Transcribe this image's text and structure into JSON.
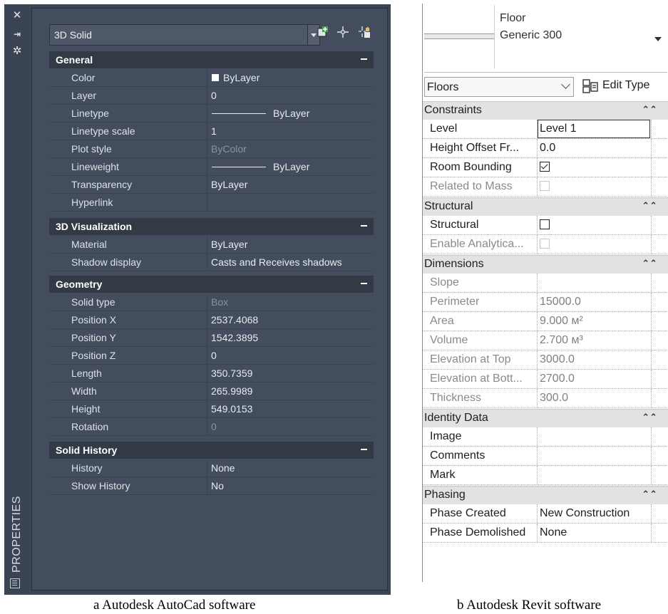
{
  "autocad": {
    "side_label": "PROPERTIES",
    "object_type": "3D Solid",
    "sections": [
      {
        "title": "General",
        "rows": [
          {
            "key": "Color",
            "value": "ByLayer"
          },
          {
            "key": "Layer",
            "value": "0"
          },
          {
            "key": "Linetype",
            "value": "ByLayer"
          },
          {
            "key": "Linetype scale",
            "value": "1"
          },
          {
            "key": "Plot style",
            "value": "ByColor"
          },
          {
            "key": "Lineweight",
            "value": "ByLayer"
          },
          {
            "key": "Transparency",
            "value": "ByLayer"
          },
          {
            "key": "Hyperlink",
            "value": ""
          }
        ]
      },
      {
        "title": "3D Visualization",
        "rows": [
          {
            "key": "Material",
            "value": "ByLayer"
          },
          {
            "key": "Shadow display",
            "value": "Casts and Receives shadows"
          }
        ]
      },
      {
        "title": "Geometry",
        "rows": [
          {
            "key": "Solid type",
            "value": "Box"
          },
          {
            "key": "Position X",
            "value": "2537.4068"
          },
          {
            "key": "Position Y",
            "value": "1542.3895"
          },
          {
            "key": "Position Z",
            "value": "0"
          },
          {
            "key": "Length",
            "value": "350.7359"
          },
          {
            "key": "Width",
            "value": "265.9989"
          },
          {
            "key": "Height",
            "value": "549.0153"
          },
          {
            "key": "Rotation",
            "value": "0"
          }
        ]
      },
      {
        "title": "Solid History",
        "rows": [
          {
            "key": "History",
            "value": "None"
          },
          {
            "key": "Show History",
            "value": "No"
          }
        ]
      }
    ]
  },
  "revit": {
    "family": "Floor",
    "type": "Generic 300",
    "category": "Floors",
    "edit_type_label": "Edit Type",
    "sections": [
      {
        "title": "Constraints",
        "rows": [
          {
            "key": "Level",
            "value": "Level 1"
          },
          {
            "key": "Height Offset Fr...",
            "value": "0.0"
          },
          {
            "key": "Room Bounding",
            "value": ""
          },
          {
            "key": "Related to Mass",
            "value": ""
          }
        ]
      },
      {
        "title": "Structural",
        "rows": [
          {
            "key": "Structural",
            "value": ""
          },
          {
            "key": "Enable Analytica...",
            "value": ""
          }
        ]
      },
      {
        "title": "Dimensions",
        "rows": [
          {
            "key": "Slope",
            "value": ""
          },
          {
            "key": "Perimeter",
            "value": "15000.0"
          },
          {
            "key": "Area",
            "value": "9.000 м²"
          },
          {
            "key": "Volume",
            "value": "2.700 м³"
          },
          {
            "key": "Elevation at Top",
            "value": "3000.0"
          },
          {
            "key": "Elevation at Bott...",
            "value": "2700.0"
          },
          {
            "key": "Thickness",
            "value": "300.0"
          }
        ]
      },
      {
        "title": "Identity Data",
        "rows": [
          {
            "key": "Image",
            "value": ""
          },
          {
            "key": "Comments",
            "value": ""
          },
          {
            "key": "Mark",
            "value": ""
          }
        ]
      },
      {
        "title": "Phasing",
        "rows": [
          {
            "key": "Phase Created",
            "value": "New Construction"
          },
          {
            "key": "Phase Demolished",
            "value": "None"
          }
        ]
      }
    ]
  },
  "captions": {
    "a": "a Autodesk AutoCad software",
    "b": "b Autodesk Revit software"
  }
}
